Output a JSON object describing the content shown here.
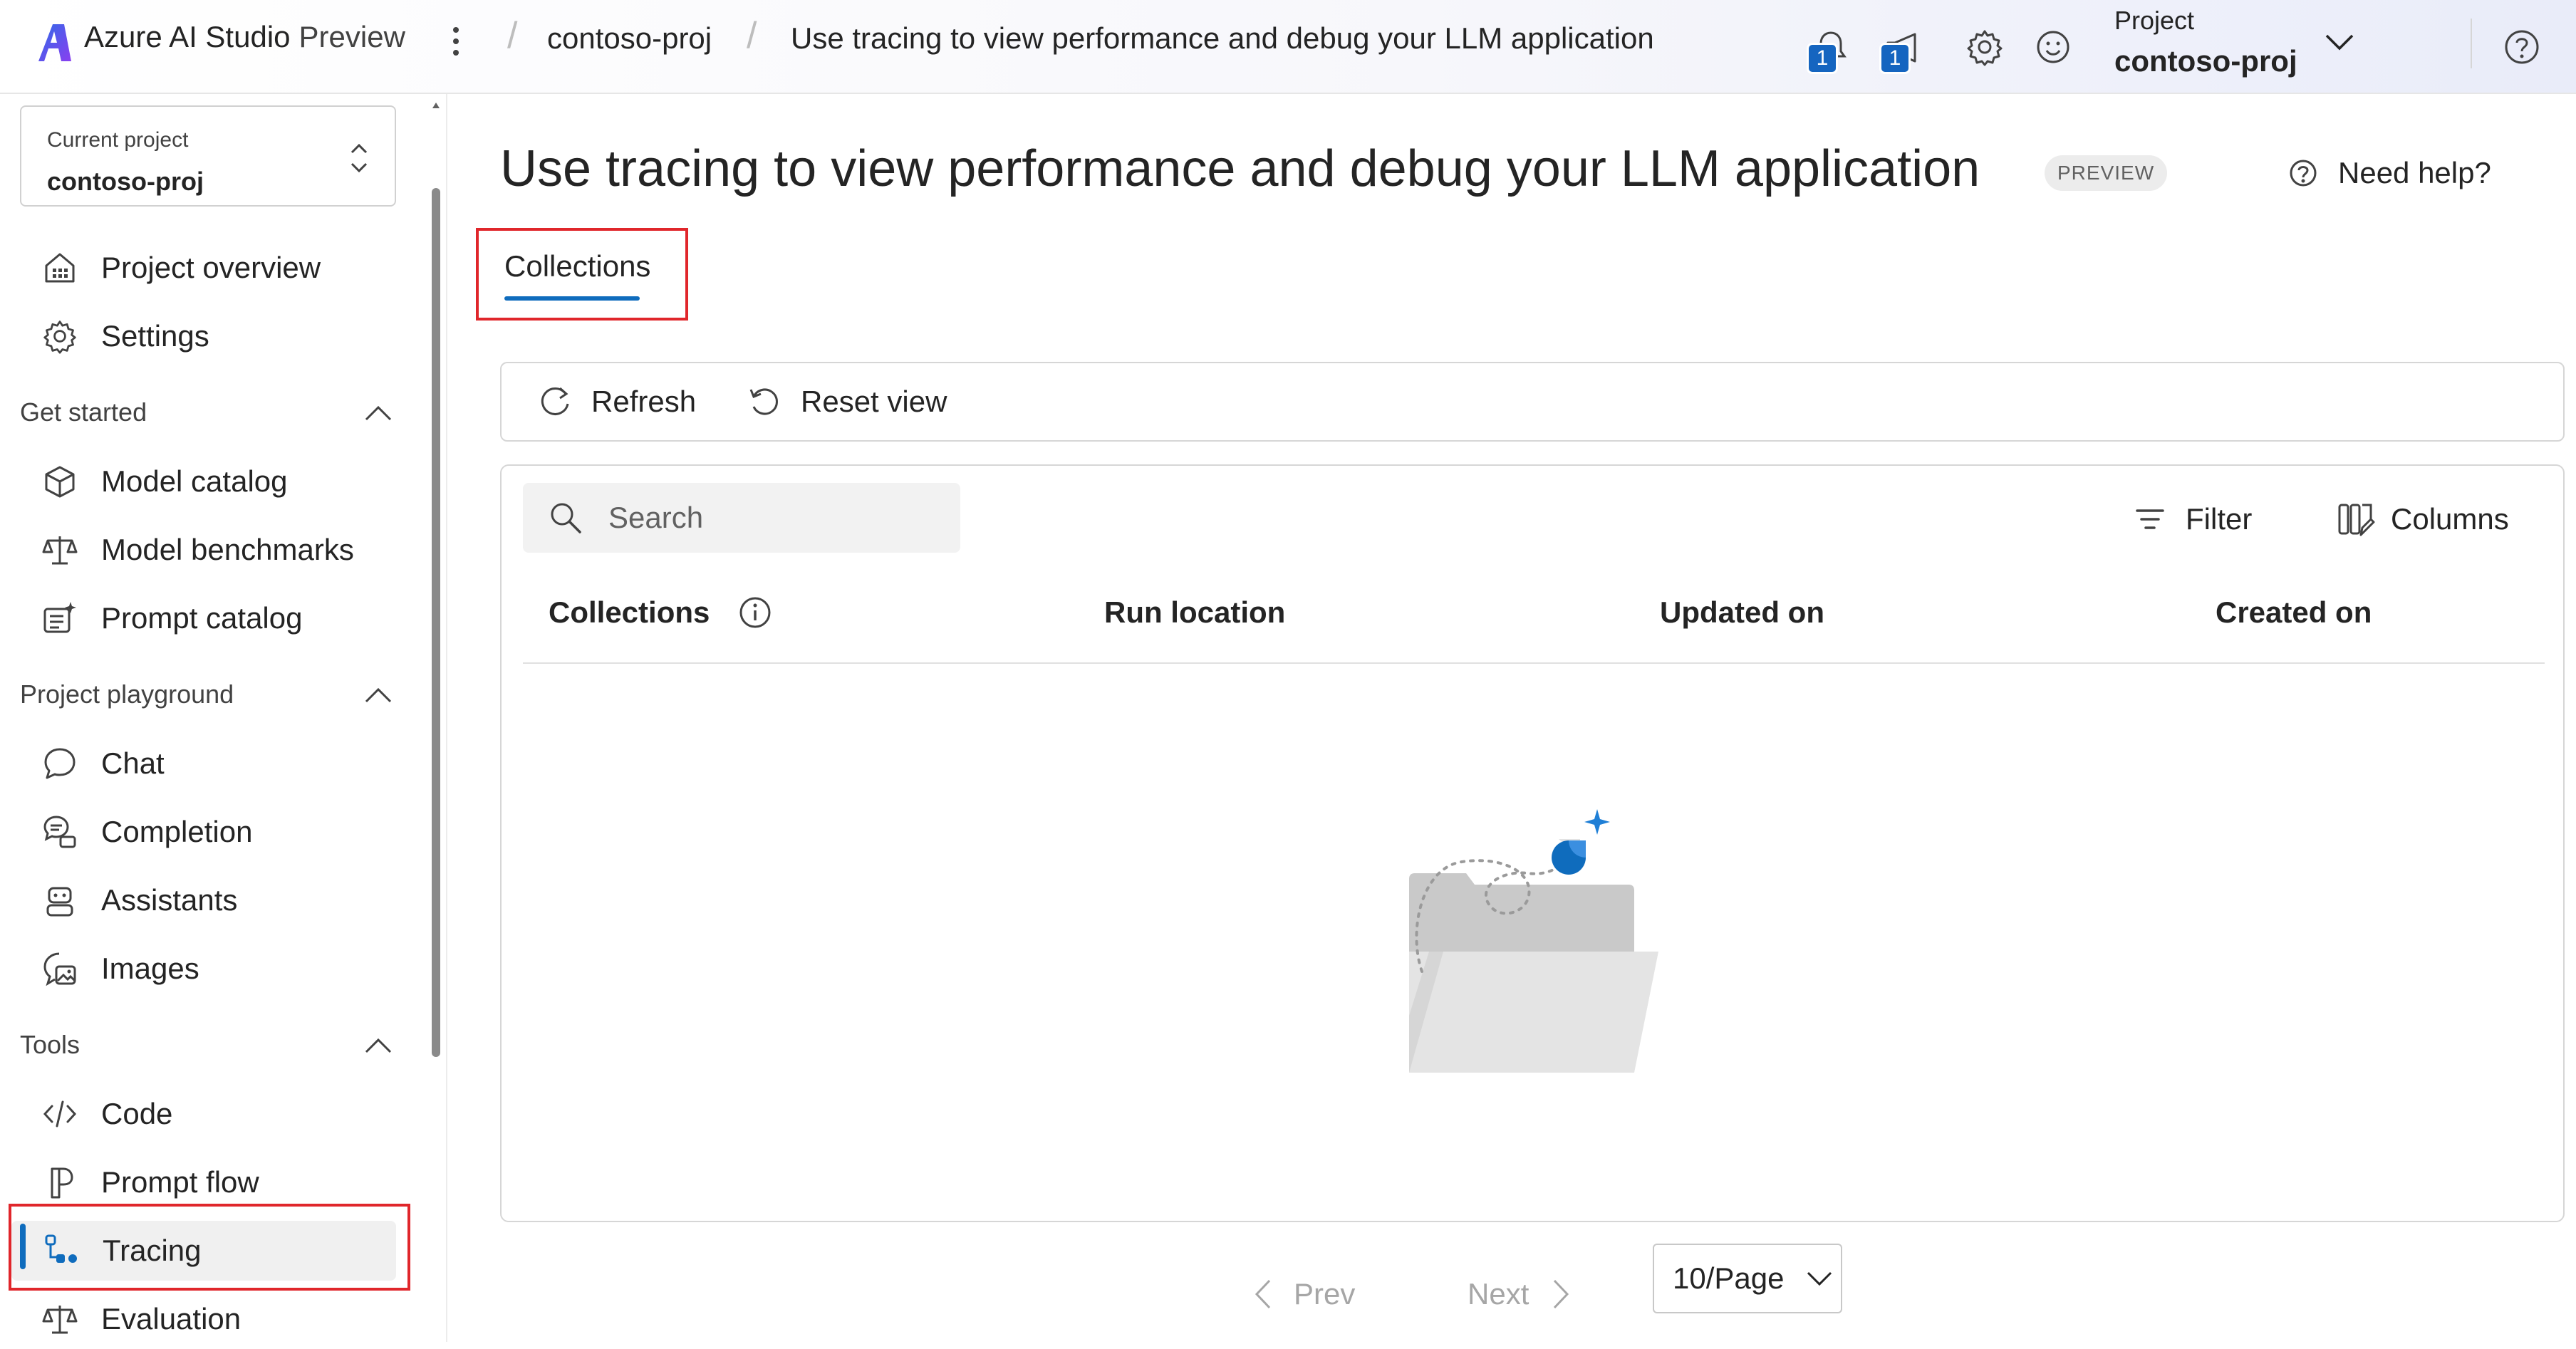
{
  "app": {
    "title": "Azure AI Studio",
    "title_suffix": "Preview",
    "brand_color": "#0f6cbd"
  },
  "breadcrumb": {
    "items": [
      "contoso-proj",
      "Use tracing to view performance and debug your LLM application"
    ]
  },
  "topbar": {
    "notifications_count": "1",
    "announcements_count": "1",
    "project_label": "Project",
    "project_name": "contoso-proj",
    "icons": [
      "more-icon",
      "bell-icon",
      "megaphone-icon",
      "gear-icon",
      "smiley-icon",
      "chevron-down-icon",
      "help-icon"
    ]
  },
  "sidebar": {
    "current_project_label": "Current project",
    "current_project_value": "contoso-proj",
    "top_items": [
      {
        "label": "Project overview",
        "icon": "dashboard-icon"
      },
      {
        "label": "Settings",
        "icon": "gear-icon"
      }
    ],
    "sections": [
      {
        "title": "Get started",
        "items": [
          {
            "label": "Model catalog",
            "icon": "cube-icon"
          },
          {
            "label": "Model benchmarks",
            "icon": "scale-icon"
          },
          {
            "label": "Prompt catalog",
            "icon": "prompt-sparkle-icon"
          }
        ]
      },
      {
        "title": "Project playground",
        "items": [
          {
            "label": "Chat",
            "icon": "chat-icon"
          },
          {
            "label": "Completion",
            "icon": "completion-icon"
          },
          {
            "label": "Assistants",
            "icon": "assistant-bot-icon"
          },
          {
            "label": "Images",
            "icon": "images-icon"
          }
        ]
      },
      {
        "title": "Tools",
        "items": [
          {
            "label": "Code",
            "icon": "code-icon"
          },
          {
            "label": "Prompt flow",
            "icon": "prompt-flow-icon"
          },
          {
            "label": "Tracing",
            "icon": "tracing-icon",
            "active": true
          },
          {
            "label": "Evaluation",
            "icon": "scale-icon"
          }
        ]
      }
    ]
  },
  "main": {
    "title": "Use tracing to view performance and debug your LLM application",
    "badge": "PREVIEW",
    "help_label": "Need help?",
    "tabs": [
      {
        "label": "Collections",
        "selected": true
      }
    ],
    "toolbar": {
      "refresh_label": "Refresh",
      "reset_view_label": "Reset view"
    },
    "grid": {
      "search_placeholder": "Search",
      "filter_label": "Filter",
      "columns_label": "Columns",
      "columns": [
        "Collections",
        "Run location",
        "Updated on",
        "Created on"
      ],
      "rows": []
    },
    "pagination": {
      "prev_label": "Prev",
      "next_label": "Next",
      "page_size": "10/Page"
    }
  },
  "colors": {
    "accent": "#0f6cbd",
    "highlight_box": "#e0262b",
    "badge_bg": "#1565c0"
  }
}
